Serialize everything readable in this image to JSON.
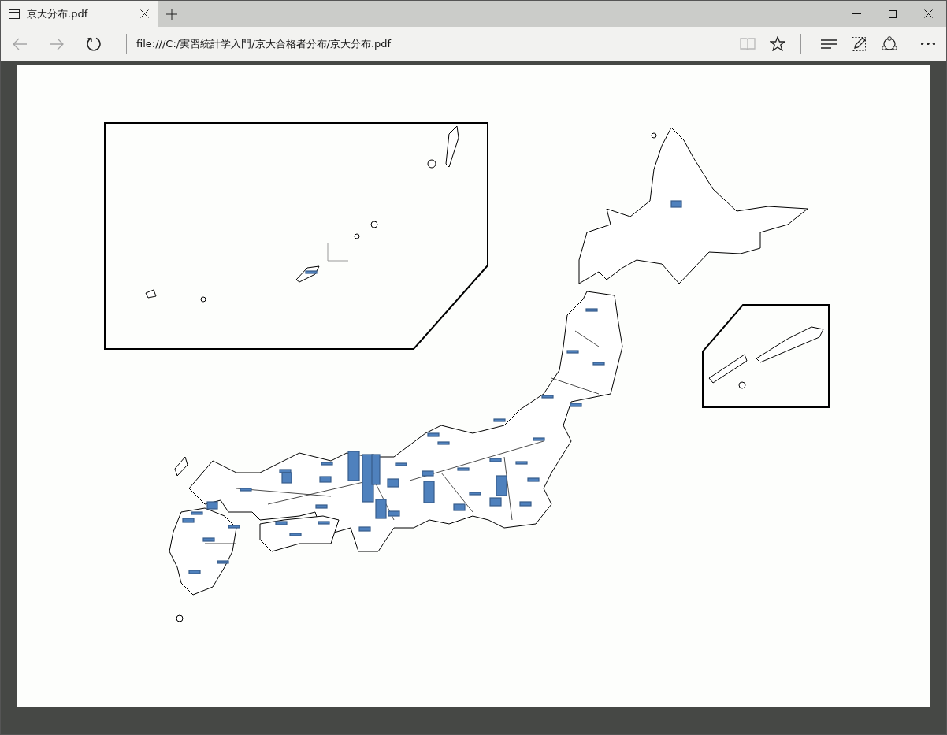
{
  "tab": {
    "title": "京大分布.pdf",
    "selected": true
  },
  "address_bar": {
    "value": "file:///C:/実習統計学入門/京大合格者分布/京大分布.pdf"
  },
  "navigation": {
    "back_disabled": true,
    "forward_disabled": true,
    "reading_view_disabled": true
  }
}
